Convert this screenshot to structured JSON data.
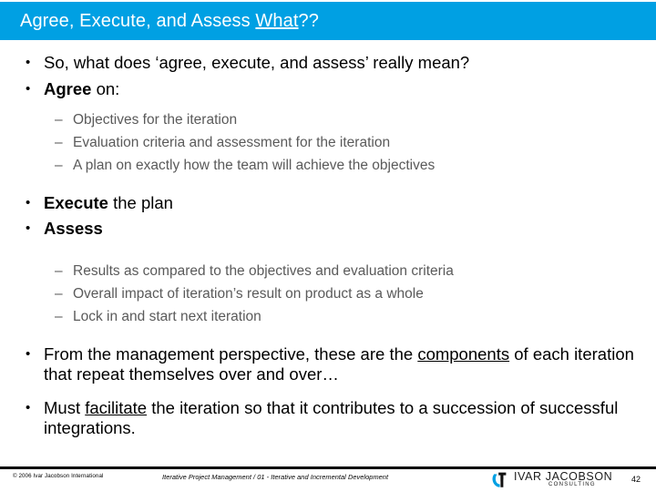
{
  "slide": {
    "title": {
      "before": "Agree, Execute, and Assess ",
      "underlined": "What",
      "after": "??"
    },
    "accent_color": "#00a0e3",
    "body_text_color": "#000000",
    "sub_text_color": "#5a5a5a",
    "bullet_marker": "•",
    "sub_bullet_marker": "–",
    "bullets": {
      "b1": "So, what does ‘agree, execute, and assess’ really mean?",
      "b2_bold": "Agree",
      "b2_rest": " on:",
      "s1": "Objectives for the iteration",
      "s2": "Evaluation criteria and assessment for the iteration",
      "s3": "A plan on exactly how the team will achieve the objectives",
      "b3_bold": "Execute",
      "b3_rest": " the plan",
      "b4_bold": "Assess",
      "s4": "Results as compared to the objectives and evaluation criteria",
      "s5": "Overall impact of iteration’s result on product as a whole",
      "s6": "Lock in and start next iteration",
      "b5_part1": "From the management perspective, these are the ",
      "b5_underlined": "components",
      "b5_part2": " of each iteration that repeat themselves over and over…",
      "b6_part1": "Must ",
      "b6_underlined": "facilitate",
      "b6_part2": " the iteration so that it contributes to a succession of successful integrations."
    }
  },
  "footer": {
    "copyright": "© 2006 Ivar Jacobson International",
    "center": "Iterative Project Management / 01 - Iterative and Incremental Development",
    "logo_name": "IVAR JACOBSON",
    "logo_tagline": "CONSULTING",
    "page_number": "42"
  }
}
